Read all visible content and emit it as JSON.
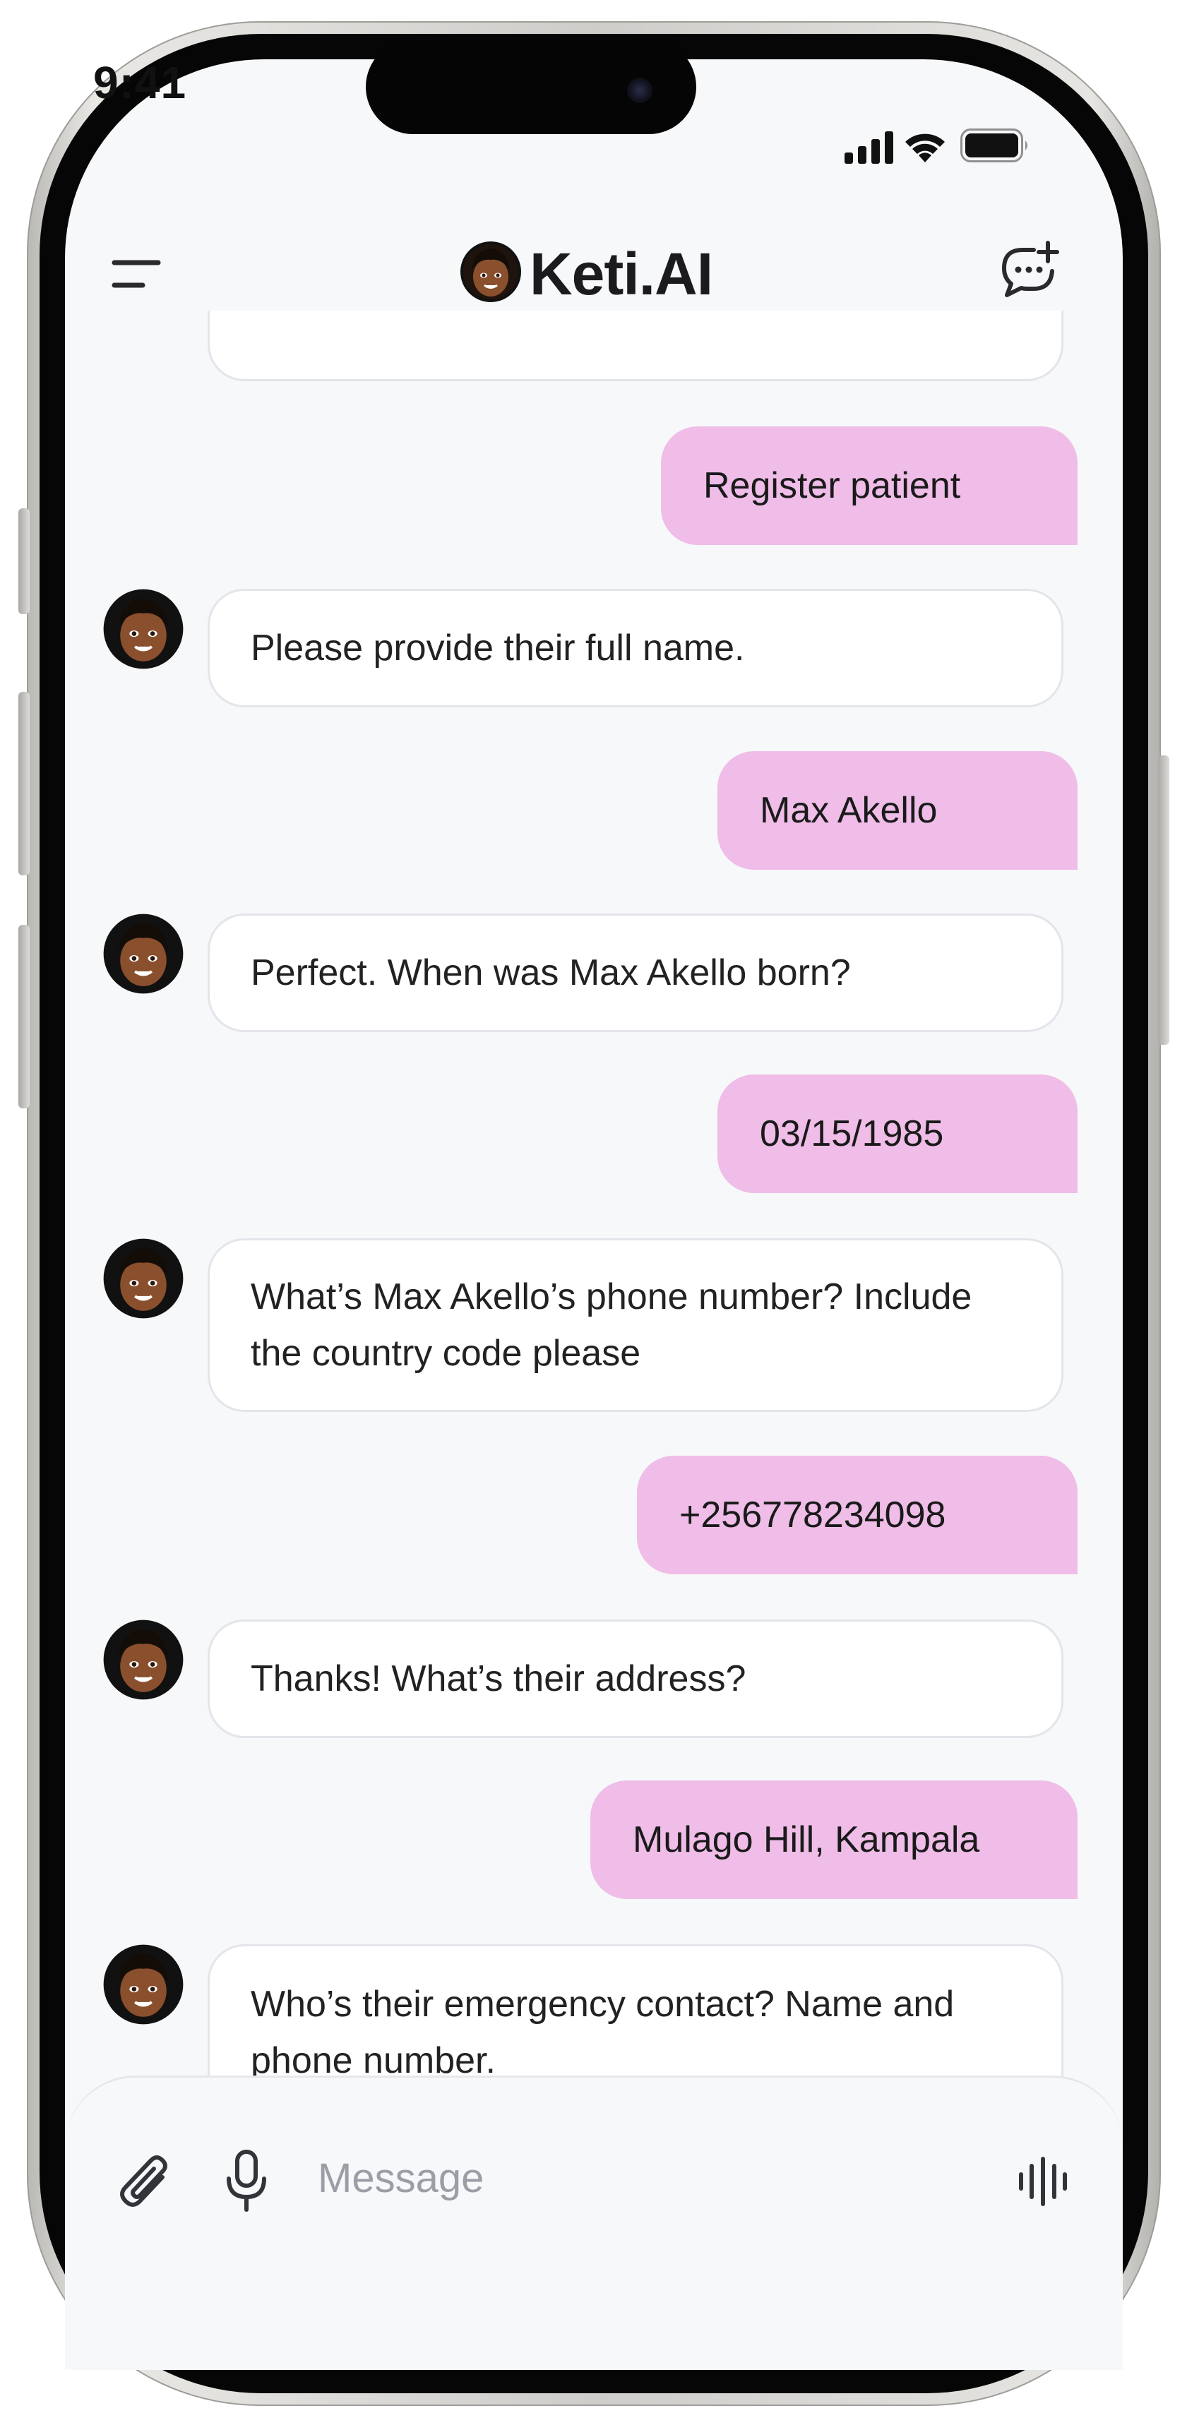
{
  "status_bar": {
    "time": "9:41"
  },
  "header": {
    "brand": "Keti.AI"
  },
  "conversation": [
    {
      "role": "user",
      "text": "Register patient"
    },
    {
      "role": "assistant",
      "text": "Please provide their full name."
    },
    {
      "role": "user",
      "text": "Max Akello"
    },
    {
      "role": "assistant",
      "text": "Perfect. When was Max Akello born?"
    },
    {
      "role": "user",
      "text": "03/15/1985"
    },
    {
      "role": "assistant",
      "text": "What’s Max Akello’s phone number? Include the country code please"
    },
    {
      "role": "user",
      "text": "+256778234098"
    },
    {
      "role": "assistant",
      "text": "Thanks! What’s their address?"
    },
    {
      "role": "user",
      "text": "Mulago Hill, Kampala"
    },
    {
      "role": "assistant",
      "text": "Who’s their emergency contact? Name and phone number."
    }
  ],
  "composer": {
    "placeholder": "Message",
    "value": ""
  },
  "colors": {
    "user_bubble": "#efbde7",
    "assistant_bubble": "#ffffff",
    "screen_background": "#f7f8fa",
    "text": "#1a1a1a"
  },
  "icons": [
    "menu-icon",
    "new-chat-icon",
    "paperclip-icon",
    "microphone-icon",
    "voice-waveform-icon",
    "signal-icon",
    "wifi-icon",
    "battery-icon"
  ]
}
